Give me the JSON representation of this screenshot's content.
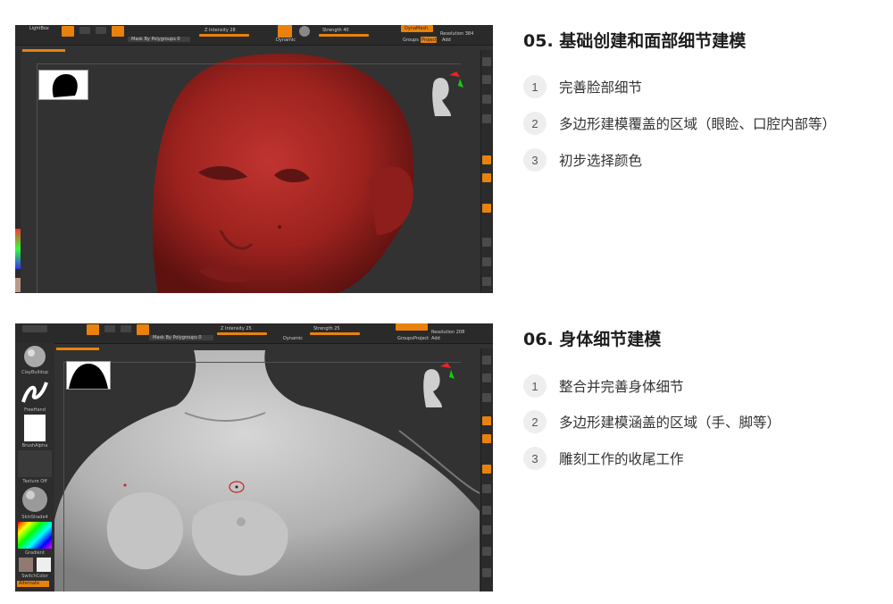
{
  "section_1": {
    "title": "05. 基础创建和面部细节建模",
    "items": [
      {
        "num": "1",
        "text": "完善脸部细节"
      },
      {
        "num": "2",
        "text": "多边形建模覆盖的区域（眼睑、口腔内部等）"
      },
      {
        "num": "3",
        "text": "初步选择颜色"
      }
    ]
  },
  "section_2": {
    "title": "06. 身体细节建模",
    "items": [
      {
        "num": "1",
        "text": "整合并完善身体细节"
      },
      {
        "num": "2",
        "text": "多边形建模涵盖的区域（手、脚等）"
      },
      {
        "num": "3",
        "text": "雕刻工作的收尾工作"
      }
    ]
  },
  "shot_1_ui": {
    "lightbox": "LightBox",
    "z_intensity": "Z Intensity 28",
    "mask": "Mask By Polygroups 0",
    "strength": "Strength 40",
    "dynamic": "Dynamic",
    "dynamesh": "DynaMesh",
    "groups": "Groups",
    "project": "Project",
    "resolution": "Resolution 384",
    "add": "Add"
  },
  "shot_2_ui": {
    "z_intensity": "Z Intensity 25",
    "mask": "Mask By Polygroups 0",
    "strength": "Strength 25",
    "dynamic": "Dynamic",
    "groups": "Groups",
    "project": "Project",
    "resolution": "Resolution 208",
    "add": "Add",
    "tools": {
      "brush": "ClayBuildup",
      "stroke": "FreeHand",
      "alpha": "BrushAlpha",
      "texture": "Texture Off",
      "material": "SkinShade4",
      "gradient": "Gradient",
      "switch_color": "SwitchColor",
      "alternate": "Alternate"
    }
  },
  "colors": {
    "accent": "#e9820c",
    "skin_red": "#a3231f",
    "body_grey": "#b8b8b8",
    "viewport_bg": "#323232"
  }
}
